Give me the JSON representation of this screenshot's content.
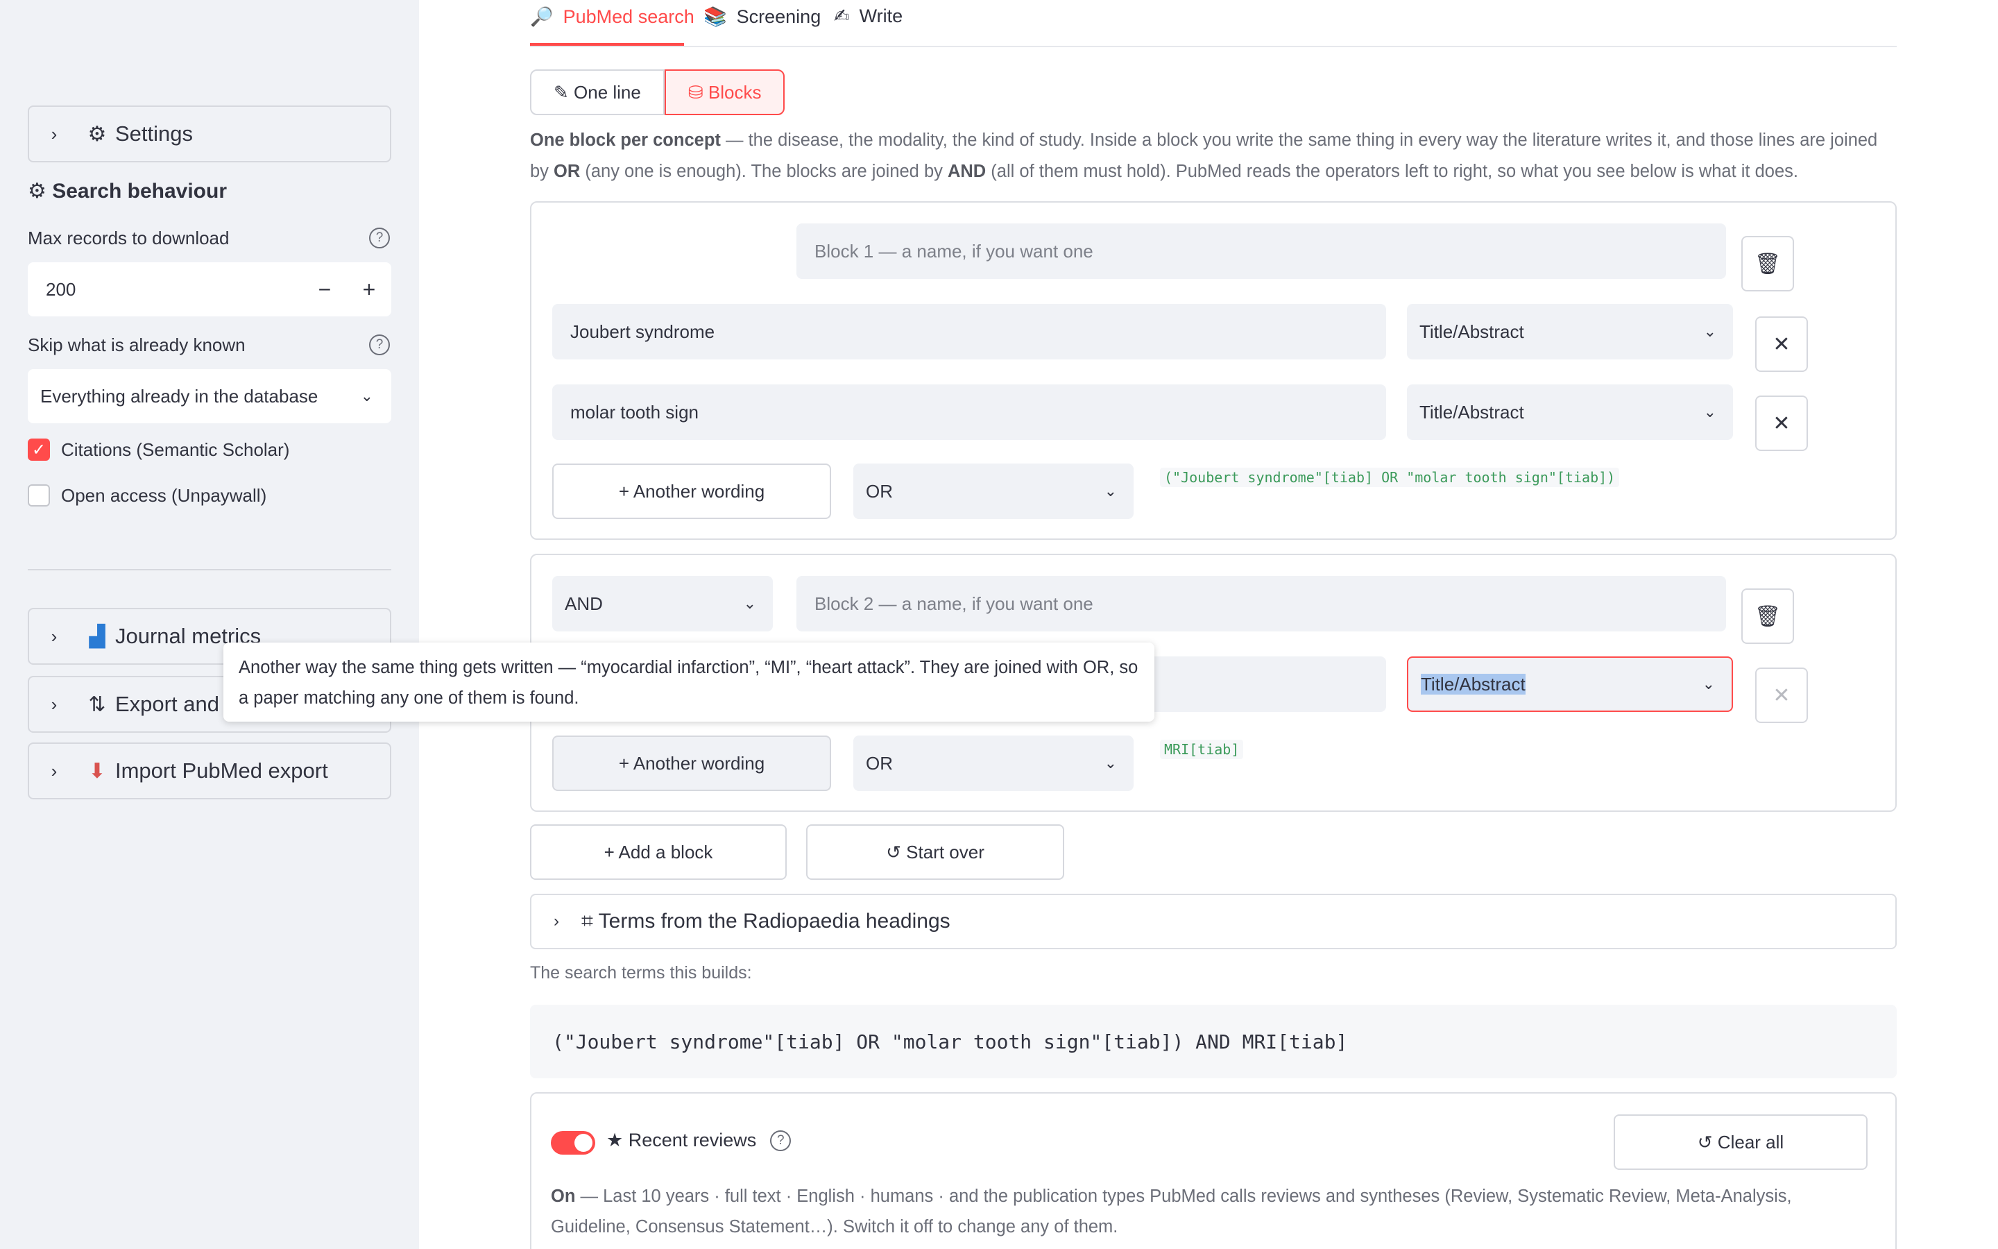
{
  "sidebar": {
    "settings_label": "Settings",
    "search_behaviour_heading": "⚙ Search behaviour",
    "max_records": {
      "label": "Max records to download",
      "value": "200",
      "minus": "−",
      "plus": "+"
    },
    "skip_known": {
      "label": "Skip what is already known",
      "selected": "Everything already in the database"
    },
    "checkboxes": [
      {
        "label": "Citations (Semantic Scholar)",
        "checked": true
      },
      {
        "label": "Open access (Unpaywall)",
        "checked": false
      }
    ],
    "expanders": [
      {
        "label": "Journal metrics",
        "icon": "bar-chart-icon"
      },
      {
        "label": "Export and b",
        "icon": "arrows-up-down-icon"
      },
      {
        "label": "Import PubMed export",
        "icon": "inbox-tray-icon"
      }
    ],
    "help_glyph": "?"
  },
  "tabs": [
    {
      "label": "PubMed search",
      "icon": "magnifier-icon",
      "active": true
    },
    {
      "label": "Screening",
      "icon": "books-icon",
      "active": false
    },
    {
      "label": "Write",
      "icon": "pencil-icon",
      "active": false
    }
  ],
  "mode_toggle": {
    "one_line": "✎ One line",
    "blocks": "⛁ Blocks",
    "selected": "Blocks"
  },
  "intro": {
    "lead": "One block per concept",
    "text1": " — the disease, the modality, the kind of study. Inside a block you write the same thing in every way the literature writes it, and those lines are joined by ",
    "or": "OR",
    "text2": " (any one is enough). The blocks are joined by ",
    "and": "AND",
    "text3": " (all of them must hold). PubMed reads the operators left to right, so what you see below is what it does."
  },
  "blocks": [
    {
      "name_placeholder": "Block 1 — a name, if you want one",
      "rows": [
        {
          "term": "Joubert syndrome",
          "field": "Title/Abstract"
        },
        {
          "term": "molar tooth sign",
          "field": "Title/Abstract"
        }
      ],
      "add_wording": "+ Another wording",
      "joiner": "OR",
      "preview": "(\"Joubert syndrome\"[tiab] OR \"molar tooth sign\"[tiab])"
    },
    {
      "operator": "AND",
      "name_placeholder": "Block 2 — a name, if you want one",
      "rows": [
        {
          "term": "",
          "field": "Title/Abstract"
        }
      ],
      "add_wording": "+ Another wording",
      "joiner": "OR",
      "preview": "MRI[tiab]"
    }
  ],
  "actions": {
    "add_block": "+ Add a block",
    "start_over": "↺ Start over"
  },
  "terms_expander": "⌗ Terms from the Radiopaedia headings",
  "search_terms_caption": "The search terms this builds:",
  "query": "(\"Joubert syndrome\"[tiab] OR \"molar tooth sign\"[tiab]) AND MRI[tiab]",
  "reviews": {
    "label": "★ Recent reviews",
    "enabled": true,
    "clear_all": "↺ Clear all",
    "on": "On",
    "description": " — Last 10 years · full text · English · humans · and the publication types PubMed calls reviews and syntheses (Review, Systematic Review, Meta-Analysis, Guideline, Consensus Statement…). Switch it off to change any of them."
  },
  "tooltip": "Another way the same thing gets written — “myocardial infarction”, “MI”, “heart attack”. They are joined with OR, so a paper matching any one of them is found.",
  "colors": {
    "accent": "#ff4b4b",
    "sidebar_bg": "#f0f2f6",
    "code_green": "#3b9a5a"
  }
}
